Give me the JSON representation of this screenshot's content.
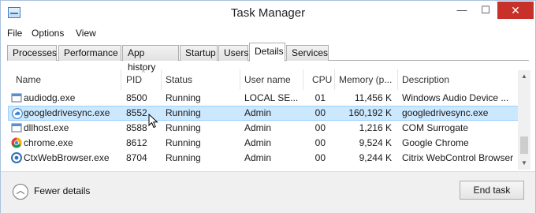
{
  "window": {
    "title": "Task Manager",
    "controls": {
      "minimize": "—",
      "maximize": "☐",
      "close": "✕"
    }
  },
  "menu": [
    "File",
    "Options",
    "View"
  ],
  "tabs": [
    {
      "label": "Processes",
      "active": false
    },
    {
      "label": "Performance",
      "active": false
    },
    {
      "label": "App history",
      "active": false
    },
    {
      "label": "Startup",
      "active": false
    },
    {
      "label": "Users",
      "active": false
    },
    {
      "label": "Details",
      "active": true
    },
    {
      "label": "Services",
      "active": false
    }
  ],
  "table": {
    "columns": [
      "Name",
      "PID",
      "Status",
      "User name",
      "CPU",
      "Memory (p...",
      "Description"
    ],
    "sorted_column": "PID",
    "sort_direction": "ascending",
    "rows": [
      {
        "name": "audiodg.exe",
        "pid": "8500",
        "status": "Running",
        "user": "LOCAL SE...",
        "cpu": "01",
        "memory": "11,456 K",
        "description": "Windows Audio Device ...",
        "icon": "generic-exe-icon",
        "selected": false
      },
      {
        "name": "googledrivesync.exe",
        "pid": "8552",
        "status": "Running",
        "user": "Admin",
        "cpu": "00",
        "memory": "160,192 K",
        "description": "googledrivesync.exe",
        "icon": "google-drive-icon",
        "selected": true
      },
      {
        "name": "dllhost.exe",
        "pid": "8588",
        "status": "Running",
        "user": "Admin",
        "cpu": "00",
        "memory": "1,216 K",
        "description": "COM Surrogate",
        "icon": "generic-exe-icon",
        "selected": false
      },
      {
        "name": "chrome.exe",
        "pid": "8612",
        "status": "Running",
        "user": "Admin",
        "cpu": "00",
        "memory": "9,524 K",
        "description": "Google Chrome",
        "icon": "chrome-icon",
        "selected": false
      },
      {
        "name": "CtxWebBrowser.exe",
        "pid": "8704",
        "status": "Running",
        "user": "Admin",
        "cpu": "00",
        "memory": "9,244 K",
        "description": "Citrix WebControl Browser",
        "icon": "citrix-icon",
        "selected": false
      }
    ]
  },
  "footer": {
    "fewer_details": "Fewer details",
    "end_task": "End task"
  },
  "colors": {
    "selection": "#cce8ff",
    "selection_border": "#99d1ff",
    "close_button": "#c7312a",
    "footer_bg": "#f0f0f0"
  }
}
